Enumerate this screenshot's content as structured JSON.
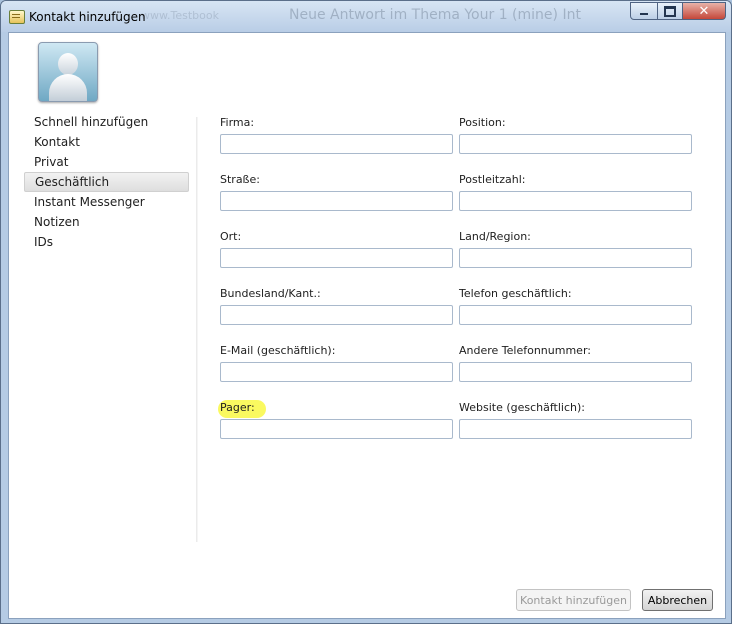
{
  "window": {
    "title": "Kontakt hinzufügen",
    "background_title": "Neue Antwort im Thema Your 1 (mine) Int",
    "background_title2": "www.Testbook",
    "controls": {
      "minimize_icon": "minimize-icon",
      "maximize_icon": "maximize-icon",
      "close_icon": "close-icon"
    }
  },
  "avatar": {
    "icon": "contact-person-icon"
  },
  "nav": {
    "items": [
      {
        "label": "Schnell hinzufügen",
        "selected": false
      },
      {
        "label": "Kontakt",
        "selected": false
      },
      {
        "label": "Privat",
        "selected": false
      },
      {
        "label": "Geschäftlich",
        "selected": true
      },
      {
        "label": "Instant Messenger",
        "selected": false
      },
      {
        "label": "Notizen",
        "selected": false
      },
      {
        "label": "IDs",
        "selected": false
      }
    ]
  },
  "form": {
    "fields": [
      {
        "label": "Firma:",
        "value": ""
      },
      {
        "label": "Position:",
        "value": ""
      },
      {
        "label": "Straße:",
        "value": ""
      },
      {
        "label": "Postleitzahl:",
        "value": ""
      },
      {
        "label": "Ort:",
        "value": ""
      },
      {
        "label": "Land/Region:",
        "value": ""
      },
      {
        "label": "Bundesland/Kant.:",
        "value": ""
      },
      {
        "label": "Telefon geschäftlich:",
        "value": ""
      },
      {
        "label": "E-Mail (geschäftlich):",
        "value": ""
      },
      {
        "label": "Andere Telefonnummer:",
        "value": ""
      },
      {
        "label": "Pager:",
        "value": "",
        "highlighted": true,
        "highlight_color": "#f9f84f"
      },
      {
        "label": "Website (geschäftlich):",
        "value": ""
      }
    ]
  },
  "buttons": {
    "add_label": "Kontakt hinzufügen",
    "add_enabled": false,
    "cancel_label": "Abbrechen"
  }
}
